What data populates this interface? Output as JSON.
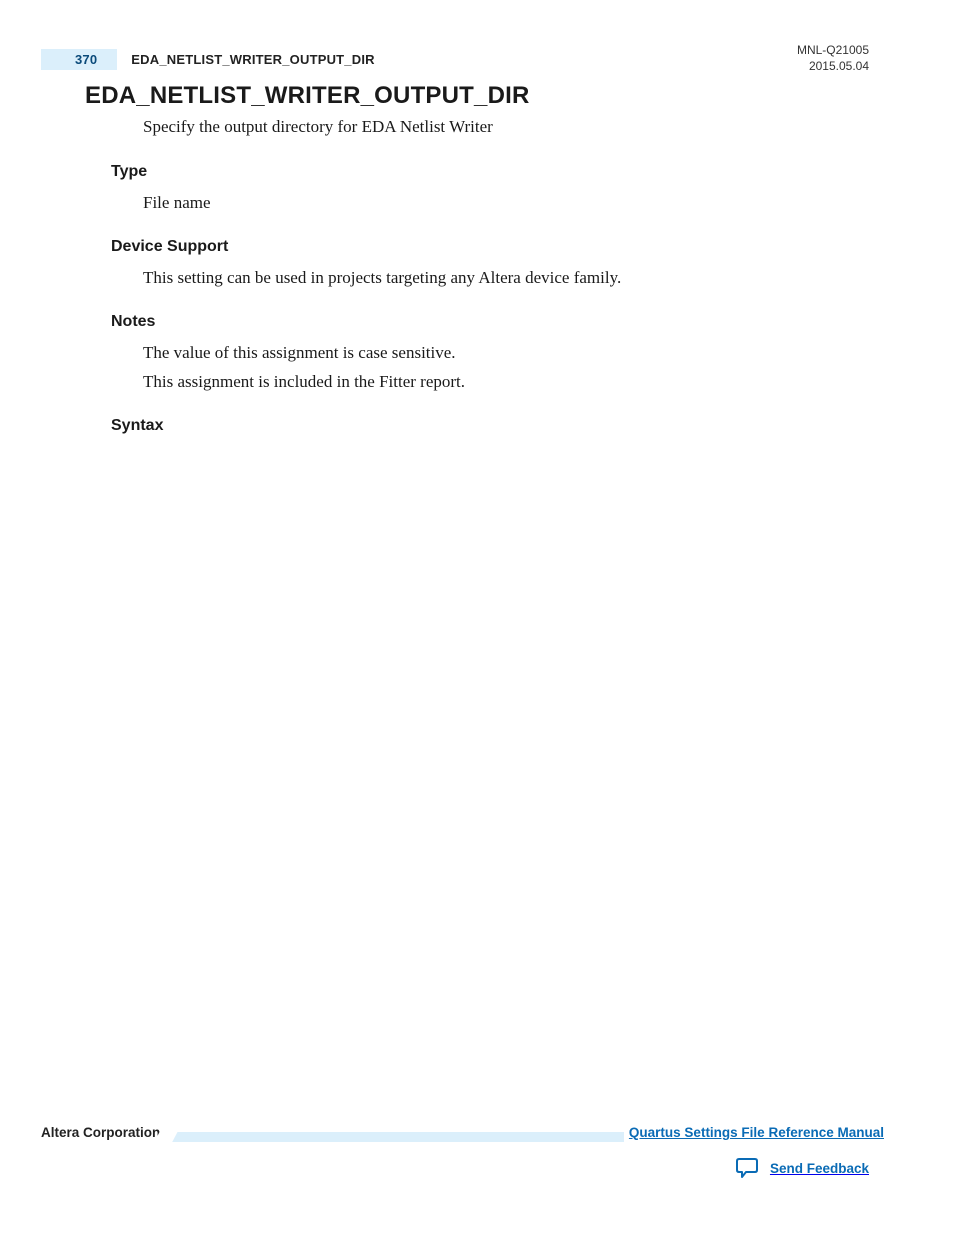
{
  "header": {
    "page_number": "370",
    "running_title": "EDA_NETLIST_WRITER_OUTPUT_DIR",
    "doc_id": "MNL-Q21005",
    "doc_date": "2015.05.04"
  },
  "main": {
    "title": "EDA_NETLIST_WRITER_OUTPUT_DIR",
    "intro": "Specify the output directory for EDA Netlist Writer",
    "sections": {
      "type": {
        "heading": "Type",
        "body": [
          "File name"
        ]
      },
      "device_support": {
        "heading": "Device Support",
        "body": [
          "This setting can be used in projects targeting any Altera device family."
        ]
      },
      "notes": {
        "heading": "Notes",
        "body": [
          "The value of this assignment is case sensitive.",
          "This assignment is included in the Fitter report."
        ]
      },
      "syntax": {
        "heading": "Syntax",
        "body": []
      }
    }
  },
  "footer": {
    "company": "Altera Corporation",
    "manual_link": "Quartus Settings File Reference Manual",
    "feedback": "Send Feedback"
  },
  "colors": {
    "accent_bg": "#dbeffb",
    "accent_fg": "#0a4a7a",
    "link": "#0a6bb5"
  }
}
